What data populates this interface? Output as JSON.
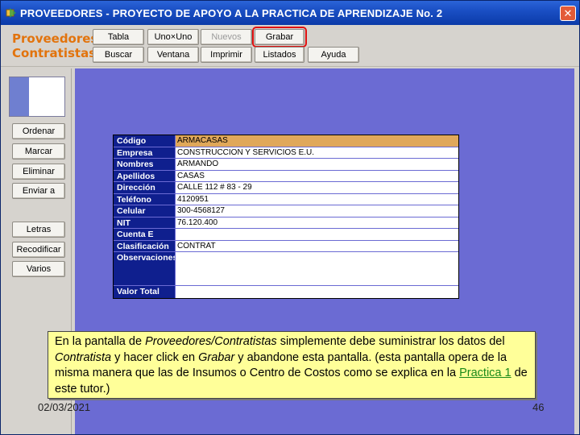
{
  "window": {
    "title": "PROVEEDORES - PROYECTO DE APOYO A LA PRACTICA DE APRENDIZAJE No. 2",
    "close_glyph": "✕"
  },
  "brand": {
    "line1": "Proveedores",
    "line2": "Contratistas",
    "color": "#e2730c"
  },
  "toolbar": {
    "row1": [
      "Tabla",
      "Uno×Uno",
      "Nuevos",
      "Grabar"
    ],
    "row2": [
      "Buscar",
      "Ventana",
      "Imprimir",
      "Listados",
      "Ayuda"
    ]
  },
  "sidebar": {
    "buttons": [
      "Ordenar",
      "Marcar",
      "Eliminar",
      "Enviar a",
      "Letras",
      "Recodificar",
      "Varios"
    ]
  },
  "form": {
    "rows": [
      {
        "label": "Código",
        "value": "ARMACASAS"
      },
      {
        "label": "Empresa",
        "value": "CONSTRUCCION Y SERVICIOS E.U."
      },
      {
        "label": "Nombres",
        "value": "ARMANDO"
      },
      {
        "label": "Apellidos",
        "value": "CASAS"
      },
      {
        "label": "Dirección",
        "value": "CALLE 112 # 83 - 29"
      },
      {
        "label": "Teléfono",
        "value": "4120951"
      },
      {
        "label": "Celular",
        "value": "300-4568127"
      },
      {
        "label": "NIT",
        "value": "76.120.400"
      },
      {
        "label": "Cuenta E",
        "value": ""
      },
      {
        "label": "Clasificación",
        "value": "CONTRAT"
      },
      {
        "label": "Observaciones",
        "value": ""
      },
      {
        "label": "Valor Total",
        "value": ""
      }
    ]
  },
  "note": {
    "p1": "En la pantalla de ",
    "p2": "Proveedores/Contratistas",
    "p3": " simplemente debe suministrar los datos del ",
    "p4": "Contratista",
    "p5": " y hacer click en ",
    "p6": "Grabar",
    "p7": " y abandone esta pantalla. (esta pantalla opera de la misma manera que las de Insumos o Centro de Costos como se explica en la ",
    "link": "Practica 1",
    "p8": " de este tutor.)"
  },
  "footer": {
    "date": "02/03/2021",
    "page": "46"
  }
}
